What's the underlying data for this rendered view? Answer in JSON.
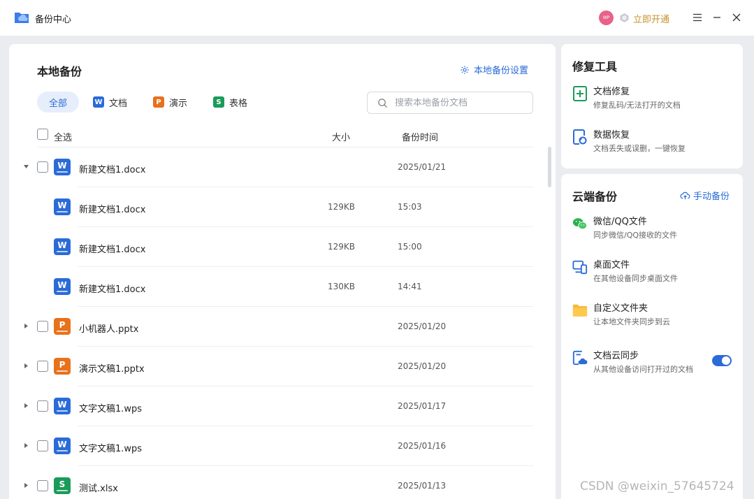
{
  "app": {
    "title": "备份中心",
    "avatar_text": "WP",
    "vip_label": "立即开通"
  },
  "local": {
    "title": "本地备份",
    "settings_label": "本地备份设置",
    "tabs": [
      {
        "label": "全部",
        "icon": ""
      },
      {
        "label": "文档",
        "icon": "W"
      },
      {
        "label": "演示",
        "icon": "P"
      },
      {
        "label": "表格",
        "icon": "S"
      }
    ],
    "search_placeholder": "搜索本地备份文档",
    "columns": {
      "select_all": "全选",
      "size": "大小",
      "time": "备份时间"
    },
    "rows": [
      {
        "type": "W",
        "name": "新建文档1.docx",
        "size": "",
        "time": "2025/01/21",
        "level": 0,
        "expanded": true
      },
      {
        "type": "W",
        "name": "新建文档1.docx",
        "size": "129KB",
        "time": "15:03",
        "level": 1
      },
      {
        "type": "W",
        "name": "新建文档1.docx",
        "size": "129KB",
        "time": "15:00",
        "level": 1
      },
      {
        "type": "W",
        "name": "新建文档1.docx",
        "size": "130KB",
        "time": "14:41",
        "level": 1
      },
      {
        "type": "P",
        "name": "小机器人.pptx",
        "size": "",
        "time": "2025/01/20",
        "level": 0,
        "expanded": false
      },
      {
        "type": "P",
        "name": "演示文稿1.pptx",
        "size": "",
        "time": "2025/01/20",
        "level": 0,
        "expanded": false
      },
      {
        "type": "W",
        "name": "文字文稿1.wps",
        "size": "",
        "time": "2025/01/17",
        "level": 0,
        "expanded": false
      },
      {
        "type": "W",
        "name": "文字文稿1.wps",
        "size": "",
        "time": "2025/01/16",
        "level": 0,
        "expanded": false
      },
      {
        "type": "S",
        "name": "测试.xlsx",
        "size": "",
        "time": "2025/01/13",
        "level": 0,
        "expanded": false
      }
    ]
  },
  "repair": {
    "title": "修复工具",
    "items": [
      {
        "title": "文档修复",
        "desc": "修复乱码/无法打开的文档",
        "icon": "doc-repair-icon"
      },
      {
        "title": "数据恢复",
        "desc": "文档丢失或误删，一键恢复",
        "icon": "data-recovery-icon"
      }
    ]
  },
  "cloud": {
    "title": "云端备份",
    "manual_label": "手动备份",
    "items": [
      {
        "title": "微信/QQ文件",
        "desc": "同步微信/QQ接收的文件",
        "icon": "wechat-icon"
      },
      {
        "title": "桌面文件",
        "desc": "在其他设备同步桌面文件",
        "icon": "desktop-icon"
      },
      {
        "title": "自定义文件夹",
        "desc": "让本地文件夹同步到云",
        "icon": "folder-icon"
      },
      {
        "title": "文档云同步",
        "desc": "从其他设备访问打开过的文档",
        "icon": "cloud-doc-icon",
        "toggle_on": true
      }
    ]
  },
  "watermark": "CSDN @weixin_57645724",
  "colors": {
    "accent": "#2a6bd8",
    "word": "#2a6bd8",
    "ppt": "#e8711c",
    "sheet": "#1b9b59",
    "vip": "#c7912c"
  }
}
